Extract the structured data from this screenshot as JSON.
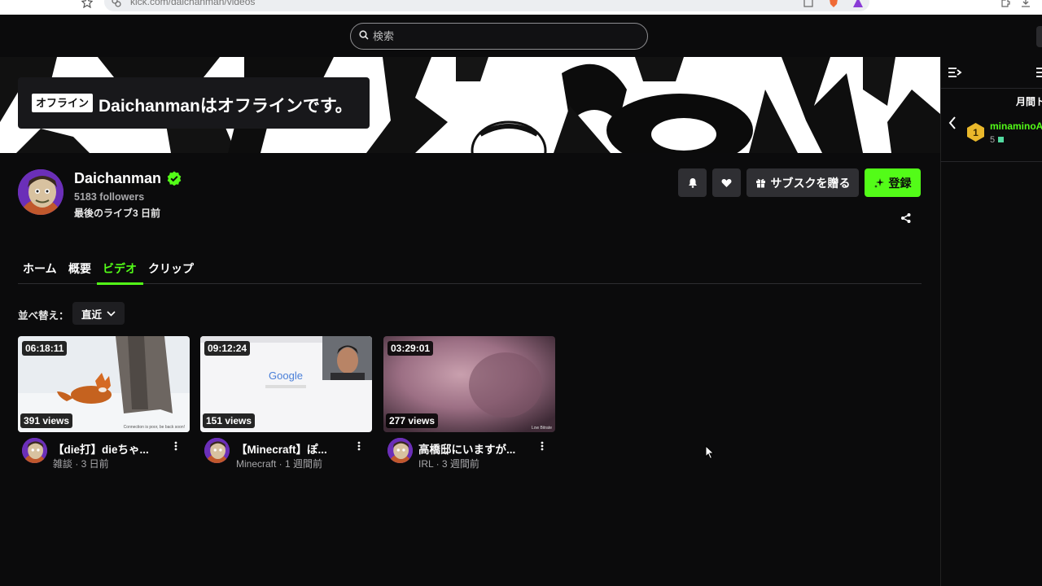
{
  "browser": {
    "url": "kick.com/daichanman/videos"
  },
  "search": {
    "placeholder": "検索"
  },
  "banner": {
    "offline_badge": "オフライン",
    "offline_message": "Daichanmanはオフラインです。"
  },
  "chat": {
    "leaderboard_title": "月間ト",
    "top_user": {
      "rank": "1",
      "name": "minaminoA",
      "count": "5"
    }
  },
  "channel": {
    "name": "Daichanman",
    "followers": "5183 followers",
    "last_live": "最後のライブ3 日前"
  },
  "actions": {
    "gift_label": "サブスクを贈る",
    "subscribe_label": "登録"
  },
  "tabs": [
    {
      "label": "ホーム"
    },
    {
      "label": "概要"
    },
    {
      "label": "ビデオ"
    },
    {
      "label": "クリップ"
    }
  ],
  "sort": {
    "label": "並べ替え：",
    "value": "直近"
  },
  "videos": [
    {
      "duration": "06:18:11",
      "views": "391 views",
      "title": "【die打】dieちゃ...",
      "meta": "雑談 · 3 日前"
    },
    {
      "duration": "09:12:24",
      "views": "151 views",
      "title": "【Minecraft】ぽ...",
      "meta": "Minecraft · 1 週間前"
    },
    {
      "duration": "03:29:01",
      "views": "277 views",
      "title": "高橋邸にいますが...",
      "meta": "IRL · 3 週間前"
    }
  ],
  "thumb_text": {
    "google": "Google"
  },
  "colors": {
    "accent": "#53fc18",
    "background": "#0b0b0c",
    "button": "#2f2f33"
  }
}
